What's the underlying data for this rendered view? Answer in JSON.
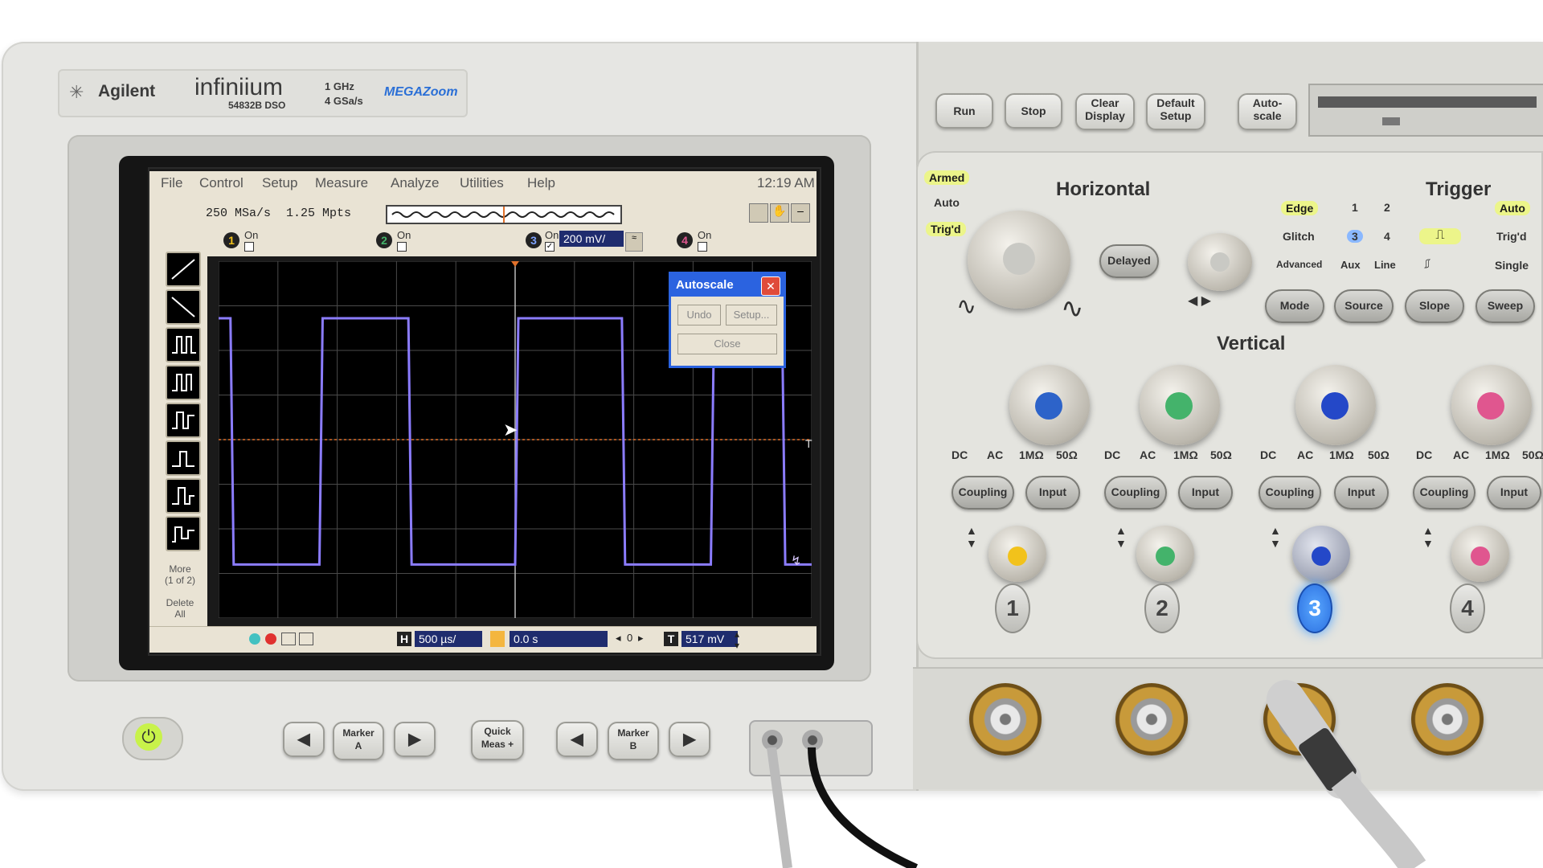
{
  "brand": {
    "maker": "Agilent",
    "product": "infiniium",
    "model": "54832B DSO",
    "spec_bandwidth": "1 GHz",
    "spec_samplerate": "4 GSa/s",
    "logo_text": "MEGAZoom"
  },
  "menu": {
    "items": [
      "File",
      "Control",
      "Setup",
      "Measure",
      "Analyze",
      "Utilities",
      "Help"
    ],
    "time": "12:19 AM"
  },
  "status": {
    "sample_rate": "250 MSa/s",
    "memory_depth": "1.25 Mpts"
  },
  "channels": [
    {
      "num": "1",
      "on_label": "On"
    },
    {
      "num": "2",
      "on_label": "On"
    },
    {
      "num": "3",
      "on_label": "On",
      "scale": "200 mV/"
    },
    {
      "num": "4",
      "on_label": "On"
    }
  ],
  "toolbox": {
    "more_label": "More\n(1 of 2)",
    "delete_label": "Delete\nAll"
  },
  "trigger_marker": "T",
  "dialog": {
    "title": "Autoscale",
    "undo": "Undo",
    "setup": "Setup...",
    "close": "Close"
  },
  "bottom": {
    "timebase_label": "H",
    "timebase": "500 µs/",
    "delay": "0.0 s",
    "delay_counter": "0",
    "trigger_label": "T",
    "trigger_level": "517 mV"
  },
  "front_panel": {
    "run_stop": [
      "Run",
      "Stop"
    ],
    "clear_display": "Clear\nDisplay",
    "default_setup": "Default\nSetup",
    "autoscale": "Auto-\nscale",
    "status_leds": [
      "Armed",
      "Auto",
      "Trig'd"
    ],
    "horizontal_title": "Horizontal",
    "delayed": "Delayed",
    "trigger_title": "Trigger",
    "trigger_types": [
      "Edge",
      "Glitch",
      "Advanced"
    ],
    "trigger_sources_row1": [
      "1",
      "2"
    ],
    "trigger_sources_row2": [
      "3",
      "4"
    ],
    "trigger_sources_row3": [
      "Aux",
      "Line"
    ],
    "trigger_modes": [
      "Auto",
      "Trig'd",
      "Single"
    ],
    "trigger_buttons": [
      "Mode",
      "Source",
      "Slope",
      "Sweep"
    ],
    "vertical_title": "Vertical",
    "coupling_options": [
      "DC",
      "AC",
      "1MΩ",
      "50Ω"
    ],
    "coupling_button": "Coupling",
    "input_button": "Input",
    "channel_numbers": [
      "1",
      "2",
      "3",
      "4"
    ],
    "marker_a": "Marker\nA",
    "quick_meas": "Quick\nMeas +",
    "marker_b": "Marker\nB"
  },
  "colors": {
    "trace": "#8b7cff",
    "trigger_line": "#e0702a",
    "ch1": "#f2c21b",
    "ch2": "#44b36b",
    "ch3": "#2448c8",
    "ch4": "#e0568f",
    "led": "#ecf58a"
  },
  "waveform": {
    "type": "square",
    "high_level_frac": 0.16,
    "low_level_frac": 0.85,
    "edges_frac": [
      0.02,
      0.17,
      0.32,
      0.5,
      0.68,
      0.83,
      0.95
    ]
  }
}
